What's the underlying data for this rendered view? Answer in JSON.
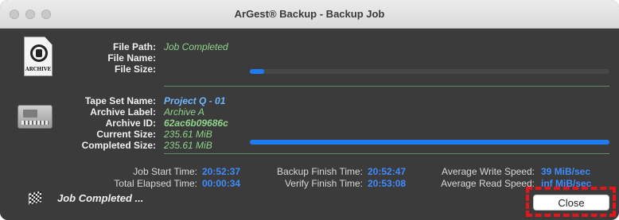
{
  "window": {
    "title": "ArGest® Backup - Backup Job"
  },
  "file": {
    "icon": "archive-file-icon",
    "icon_caption": "ARCHIVE",
    "path_label": "File Path:",
    "path_value": "Job Completed",
    "name_label": "File Name:",
    "name_value": "",
    "size_label": "File Size:",
    "size_value": "",
    "progress": 0.01
  },
  "tape": {
    "icon": "tape-cartridge-icon",
    "set_name_label": "Tape Set Name:",
    "set_name_value": "Project Q - 01",
    "archive_label_label": "Archive Label:",
    "archive_label_value": "Archive A",
    "archive_id_label": "Archive ID:",
    "archive_id_value": "62ac6b09686c",
    "current_size_label": "Current Size:",
    "current_size_value": "235.61 MiB",
    "completed_size_label": "Completed Size:",
    "completed_size_value": "235.61 MiB",
    "progress": 1.0
  },
  "stats": {
    "job_start_label": "Job Start Time:",
    "job_start_value": "20:52:37",
    "elapsed_label": "Total Elapsed Time:",
    "elapsed_value": "00:00:34",
    "backup_finish_label": "Backup Finish Time:",
    "backup_finish_value": "20:52:47",
    "verify_finish_label": "Verify Finish Time:",
    "verify_finish_value": "20:53:08",
    "avg_write_label": "Average Write Speed:",
    "avg_write_value": "39 MiB/sec",
    "avg_read_label": "Average Read Speed:",
    "avg_read_value": "inf MiB/sec"
  },
  "footer": {
    "status_icon": "checkered-flag-icon",
    "status_text": "Job Completed ...",
    "close_label": "Close"
  },
  "colors": {
    "accent": "#1e7cf0",
    "value_green": "#8fd48a",
    "value_blue": "#6fb6ff",
    "highlight": "#e8141c"
  }
}
